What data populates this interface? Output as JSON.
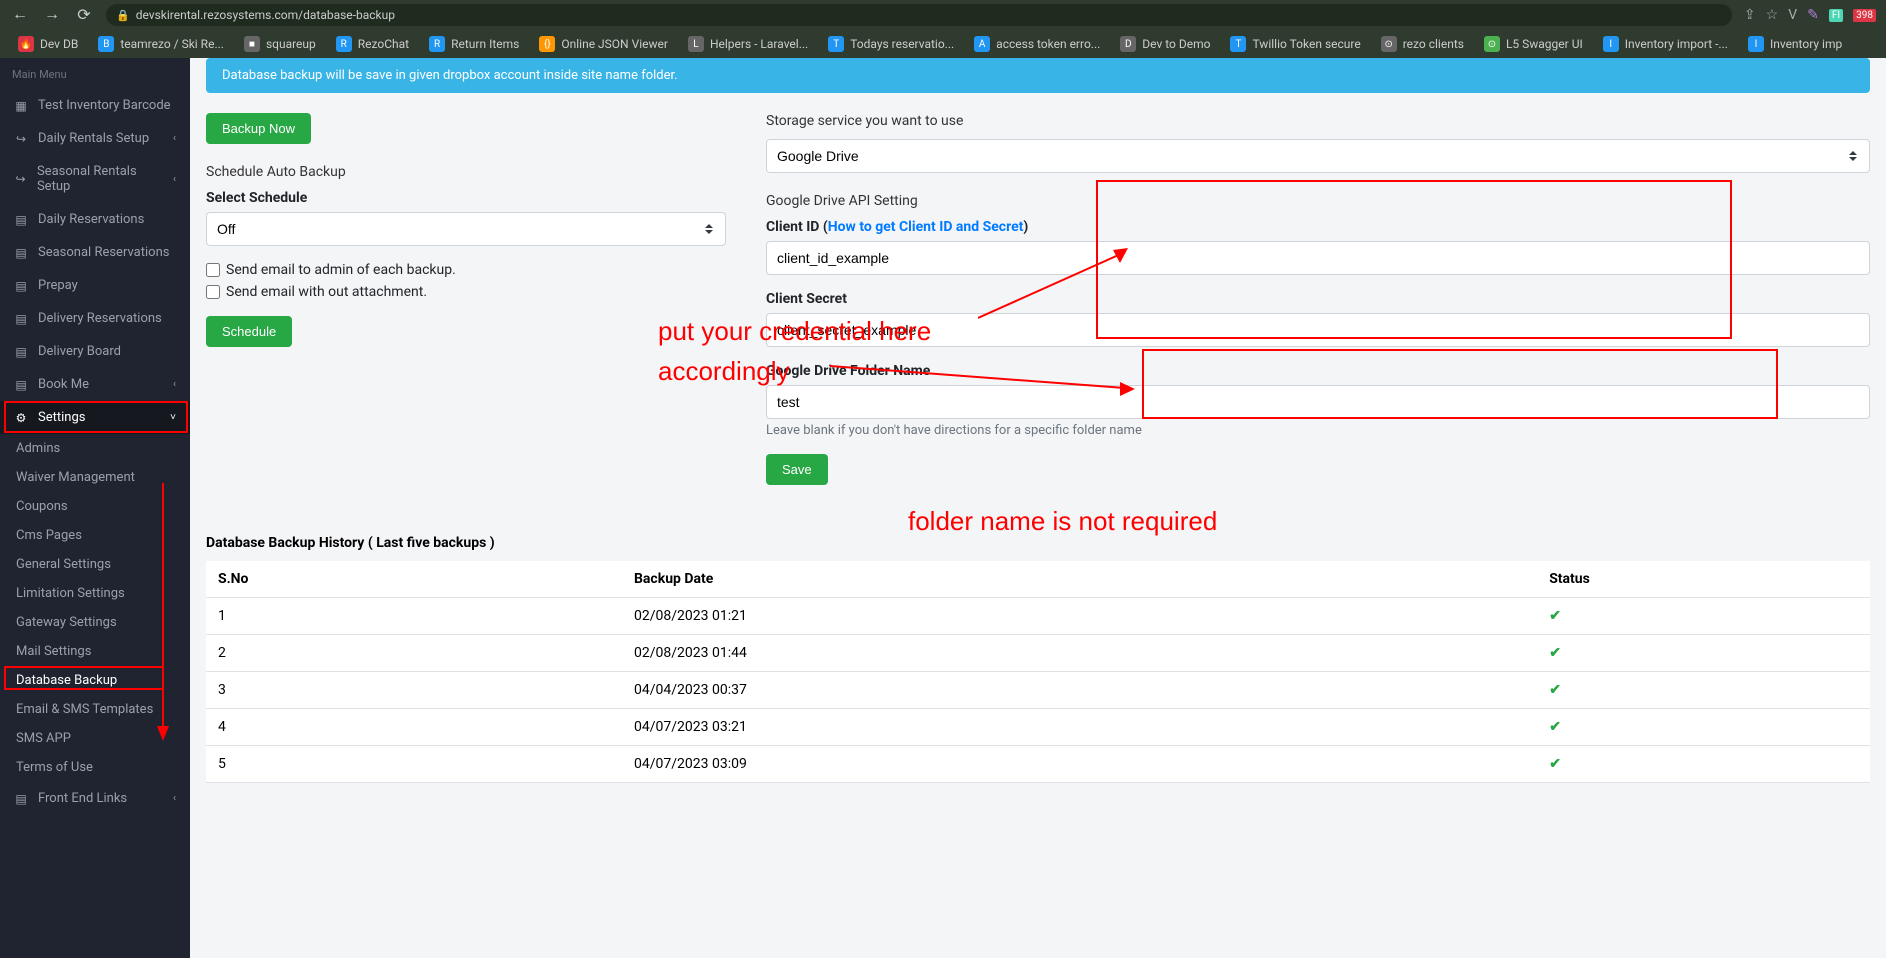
{
  "browser": {
    "url": "devskirental.rezosystems.com/database-backup"
  },
  "bookmarks": [
    {
      "label": "Dev DB",
      "icon": "red"
    },
    {
      "label": "teamrezo / Ski Re...",
      "icon": "blue"
    },
    {
      "label": "squareup",
      "icon": "gray"
    },
    {
      "label": "RezoChat",
      "icon": "blue"
    },
    {
      "label": "Return Items",
      "icon": "blue"
    },
    {
      "label": "Online JSON Viewer",
      "icon": "orange"
    },
    {
      "label": "Helpers - Laravel...",
      "icon": "gray"
    },
    {
      "label": "Todays reservatio...",
      "icon": "blue"
    },
    {
      "label": "access token erro...",
      "icon": "blue"
    },
    {
      "label": "Dev to Demo",
      "icon": "gray"
    },
    {
      "label": "Twillio Token secure",
      "icon": "blue"
    },
    {
      "label": "rezo clients",
      "icon": "gray"
    },
    {
      "label": "L5 Swagger UI",
      "icon": "green"
    },
    {
      "label": "Inventory import -...",
      "icon": "blue"
    },
    {
      "label": "Inventory imp",
      "icon": "blue"
    }
  ],
  "sidebar": {
    "main_label": "Main Menu",
    "items": [
      {
        "label": "Test Inventory Barcode",
        "icon": "barcode"
      },
      {
        "label": "Daily Rentals Setup",
        "icon": "share",
        "expandable": true
      },
      {
        "label": "Seasonal Rentals Setup",
        "icon": "share",
        "expandable": true
      },
      {
        "label": "Daily Reservations",
        "icon": "book"
      },
      {
        "label": "Seasonal Reservations",
        "icon": "book"
      },
      {
        "label": "Prepay",
        "icon": "book"
      },
      {
        "label": "Delivery Reservations",
        "icon": "book"
      },
      {
        "label": "Delivery Board",
        "icon": "book"
      },
      {
        "label": "Book Me",
        "icon": "book",
        "expandable": true
      },
      {
        "label": "Settings",
        "icon": "cogs",
        "expandable": true,
        "expanded": true
      }
    ],
    "settings_sub": [
      {
        "label": "Admins"
      },
      {
        "label": "Waiver Management"
      },
      {
        "label": "Coupons"
      },
      {
        "label": "Cms Pages"
      },
      {
        "label": "General Settings"
      },
      {
        "label": "Limitation Settings"
      },
      {
        "label": "Gateway Settings"
      },
      {
        "label": "Mail Settings"
      },
      {
        "label": "Database Backup",
        "active": true
      },
      {
        "label": "Email & SMS Templates"
      },
      {
        "label": "SMS APP"
      },
      {
        "label": "Terms of Use"
      }
    ],
    "bottom": {
      "label": "Front End Links",
      "icon": "book",
      "expandable": true
    }
  },
  "page": {
    "alert": "Database backup will be save in given dropbox account inside site name folder.",
    "backup_now": "Backup Now",
    "schedule_section": "Schedule Auto Backup",
    "select_schedule_label": "Select Schedule",
    "schedule_value": "Off",
    "checkbox1": "Send email to admin of each backup.",
    "checkbox2": "Send email with out attachment.",
    "schedule_btn": "Schedule",
    "storage_label": "Storage service you want to use",
    "storage_value": "Google Drive",
    "api_section": "Google Drive API Setting",
    "client_id_label": "Client ID",
    "client_id_help": "How to get Client ID and Secret",
    "client_id_value": "client_id_example",
    "client_secret_label": "Client Secret",
    "client_secret_value": "client_secret_example",
    "folder_label": "Google Drive Folder Name",
    "folder_value": "test",
    "folder_help": "Leave blank if you don't have directions for a specific folder name",
    "save_btn": "Save",
    "history_title": "Database Backup History ( Last five backups )",
    "table_headers": {
      "sno": "S.No",
      "date": "Backup Date",
      "status": "Status"
    },
    "history": [
      {
        "sno": "1",
        "date": "02/08/2023 01:21"
      },
      {
        "sno": "2",
        "date": "02/08/2023 01:44"
      },
      {
        "sno": "3",
        "date": "04/04/2023 00:37"
      },
      {
        "sno": "4",
        "date": "04/07/2023 03:21"
      },
      {
        "sno": "5",
        "date": "04/07/2023 03:09"
      }
    ]
  },
  "annotations": {
    "credential_text1": "put your credential here",
    "credential_text2": "accordingly",
    "folder_text": "folder name is not required"
  }
}
